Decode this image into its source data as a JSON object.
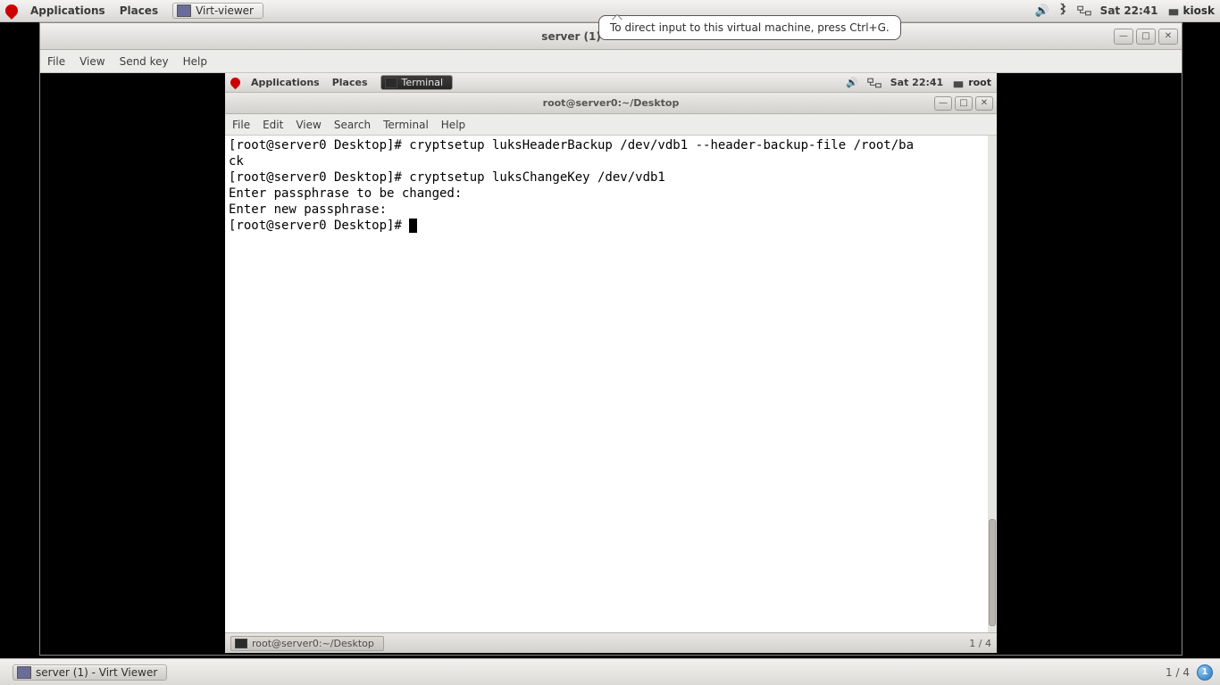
{
  "host": {
    "topbar": {
      "applications": "Applications",
      "places": "Places",
      "running_app": "Virt-viewer",
      "clock": "Sat 22:41",
      "user": "kiosk"
    },
    "tooltip": "To direct input to this virtual machine, press Ctrl+G.",
    "bottom": {
      "task": "server (1) - Virt Viewer",
      "workspace": "1 / 4",
      "ws_badge": "1"
    }
  },
  "virt": {
    "title": "server (1) - Virt Viewer",
    "menu": {
      "file": "File",
      "view": "View",
      "sendkey": "Send key",
      "help": "Help"
    }
  },
  "guest": {
    "topbar": {
      "applications": "Applications",
      "places": "Places",
      "running_app": "Terminal",
      "clock": "Sat 22:41",
      "user": "root"
    },
    "terminal": {
      "title": "root@server0:~/Desktop",
      "menu": {
        "file": "File",
        "edit": "Edit",
        "view": "View",
        "search": "Search",
        "terminal": "Terminal",
        "help": "Help"
      },
      "lines": [
        "[root@server0 Desktop]# cryptsetup luksHeaderBackup /dev/vdb1 --header-backup-file /root/ba",
        "ck",
        "[root@server0 Desktop]# cryptsetup luksChangeKey /dev/vdb1",
        "Enter passphrase to be changed: ",
        "Enter new passphrase: ",
        "[root@server0 Desktop]# "
      ]
    },
    "bottom": {
      "task": "root@server0:~/Desktop",
      "workspace": "1 / 4"
    }
  }
}
